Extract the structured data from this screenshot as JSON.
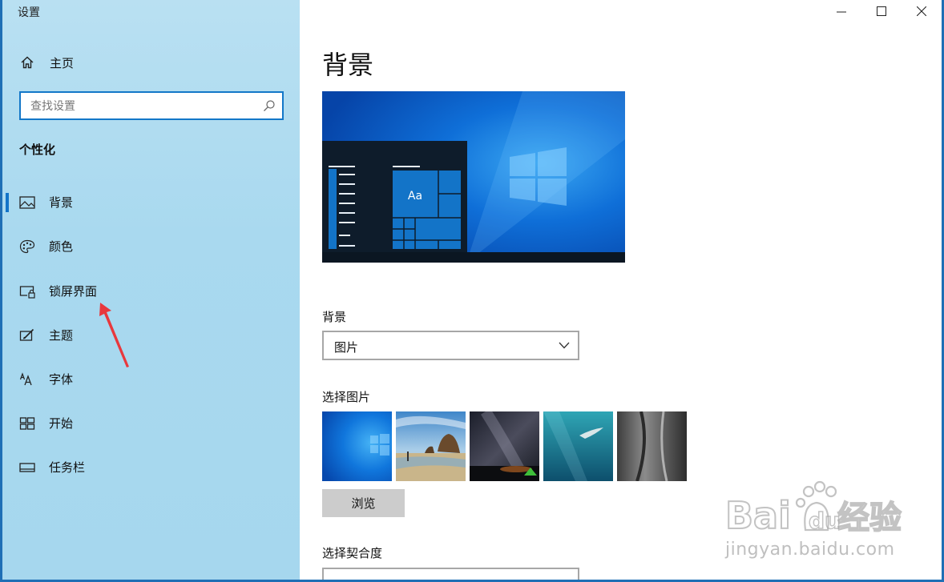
{
  "window": {
    "title": "设置"
  },
  "sidebar": {
    "home_label": "主页",
    "search_placeholder": "查找设置",
    "section_title": "个性化",
    "items": [
      {
        "label": "背景",
        "icon": "picture-icon",
        "active": true
      },
      {
        "label": "颜色",
        "icon": "palette-icon"
      },
      {
        "label": "锁屏界面",
        "icon": "lock-screen-icon"
      },
      {
        "label": "主题",
        "icon": "theme-icon"
      },
      {
        "label": "字体",
        "icon": "font-icon"
      },
      {
        "label": "开始",
        "icon": "start-icon"
      },
      {
        "label": "任务栏",
        "icon": "taskbar-icon"
      }
    ]
  },
  "main": {
    "page_title": "背景",
    "preview": {
      "tile_text": "Aa"
    },
    "background_label": "背景",
    "background_value": "图片",
    "choose_picture_label": "选择图片",
    "thumbnails": [
      "windows-blue",
      "beach-rocks",
      "night-sky",
      "underwater-swimmer",
      "rock-cliff"
    ],
    "browse_label": "浏览",
    "fit_label": "选择契合度"
  },
  "watermark": {
    "text": "jingyan.baidu.com"
  },
  "colors": {
    "accent": "#1374c8",
    "sidebar_bg": "#aad9ef"
  }
}
